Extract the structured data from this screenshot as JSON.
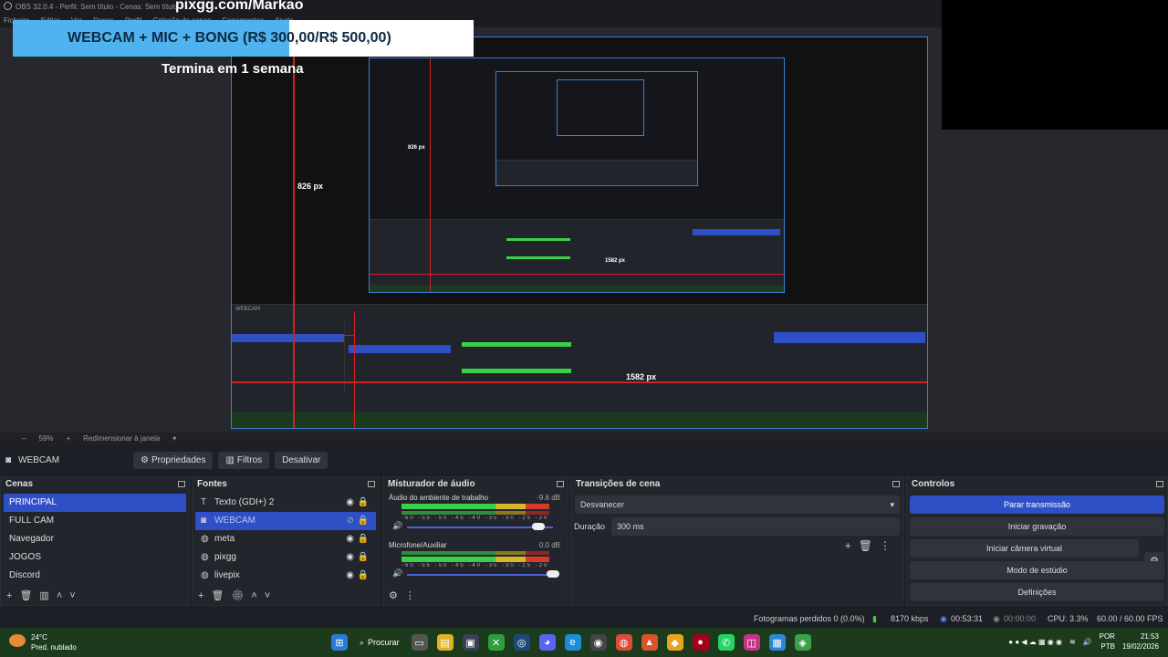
{
  "window": {
    "title": "OBS 32.0.4 - Perfil: Sem título - Cenas: Sem título",
    "overlay_url": "pixgg.com/Markao"
  },
  "menu": [
    "Ficheiro",
    "Editar",
    "Ver",
    "Docas",
    "Perfil",
    "Coleção de cenas",
    "Ferramentas",
    "Ajuda"
  ],
  "preview": {
    "banner": "WEBCAM + MIC + BONG (R$ 300,00/R$ 500,00)",
    "banner_sub": "Termina em 1 semana",
    "label_826": "826 px",
    "label_1582": "1582 px",
    "nested_label_826": "826 px",
    "nested_label_1582": "1582 px"
  },
  "scale_bar": {
    "zoom": "59%",
    "plus": "+",
    "mode": "Redimensionar à janela"
  },
  "source_toolbar": {
    "source_name": "WEBCAM",
    "properties": "Propriedades",
    "filters": "Filtros",
    "deactivate": "Desativar"
  },
  "scenes": {
    "title": "Cenas",
    "items": [
      "PRINCIPAL",
      "FULL CAM",
      "Navegador",
      "JOGOS",
      "Discord"
    ],
    "selected": "PRINCIPAL"
  },
  "sources": {
    "title": "Fontes",
    "items": [
      {
        "icon": "text-icon",
        "label": "Texto (GDI+) 2"
      },
      {
        "icon": "camera-icon",
        "label": "WEBCAM"
      },
      {
        "icon": "globe-icon",
        "label": "meta"
      },
      {
        "icon": "globe-icon",
        "label": "pixgg"
      },
      {
        "icon": "globe-icon",
        "label": "livepix"
      }
    ],
    "selected": "WEBCAM"
  },
  "mixer": {
    "title": "Misturador de áudio",
    "channels": [
      {
        "name": "Áudio do ambiente de trabalho",
        "db": "-9.6 dB",
        "volume": 0.9
      },
      {
        "name": "Microfone/Auxiliar",
        "db": "0.0 dB",
        "volume": 1.0
      }
    ],
    "ticks": "-60 -55 -50 -45 -40 -35 -30 -25 -20 -15 -10 -5 0"
  },
  "transitions": {
    "title": "Transições de cena",
    "selected": "Desvanecer",
    "duration_label": "Duração",
    "duration_value": "300 ms"
  },
  "controls": {
    "title": "Controlos",
    "buttons": [
      "Parar transmissão",
      "Iniciar gravação",
      "Iniciar câmera virtual",
      "Modo de estúdio",
      "Definições"
    ]
  },
  "status": {
    "dropped_frames": "Fotogramas perdidos 0 (0.0%)",
    "bitrate": "8170 kbps",
    "stream_time": "00:53:31",
    "rec_time": "00:00:00",
    "cpu": "CPU: 3.3%",
    "fps": "60.00 / 60.00 FPS"
  },
  "taskbar": {
    "temperature": "24°C",
    "weather": "Pred. nublado",
    "search": "Procurar",
    "lang_top": "POR",
    "lang_bottom": "PTB",
    "time": "21:53",
    "date": "19/02/2026"
  },
  "colors": {
    "accent": "#2f4fc7",
    "banner": "#4fb3f0",
    "guide_red": "#d42020",
    "taskbar": "#1c3a1c"
  }
}
